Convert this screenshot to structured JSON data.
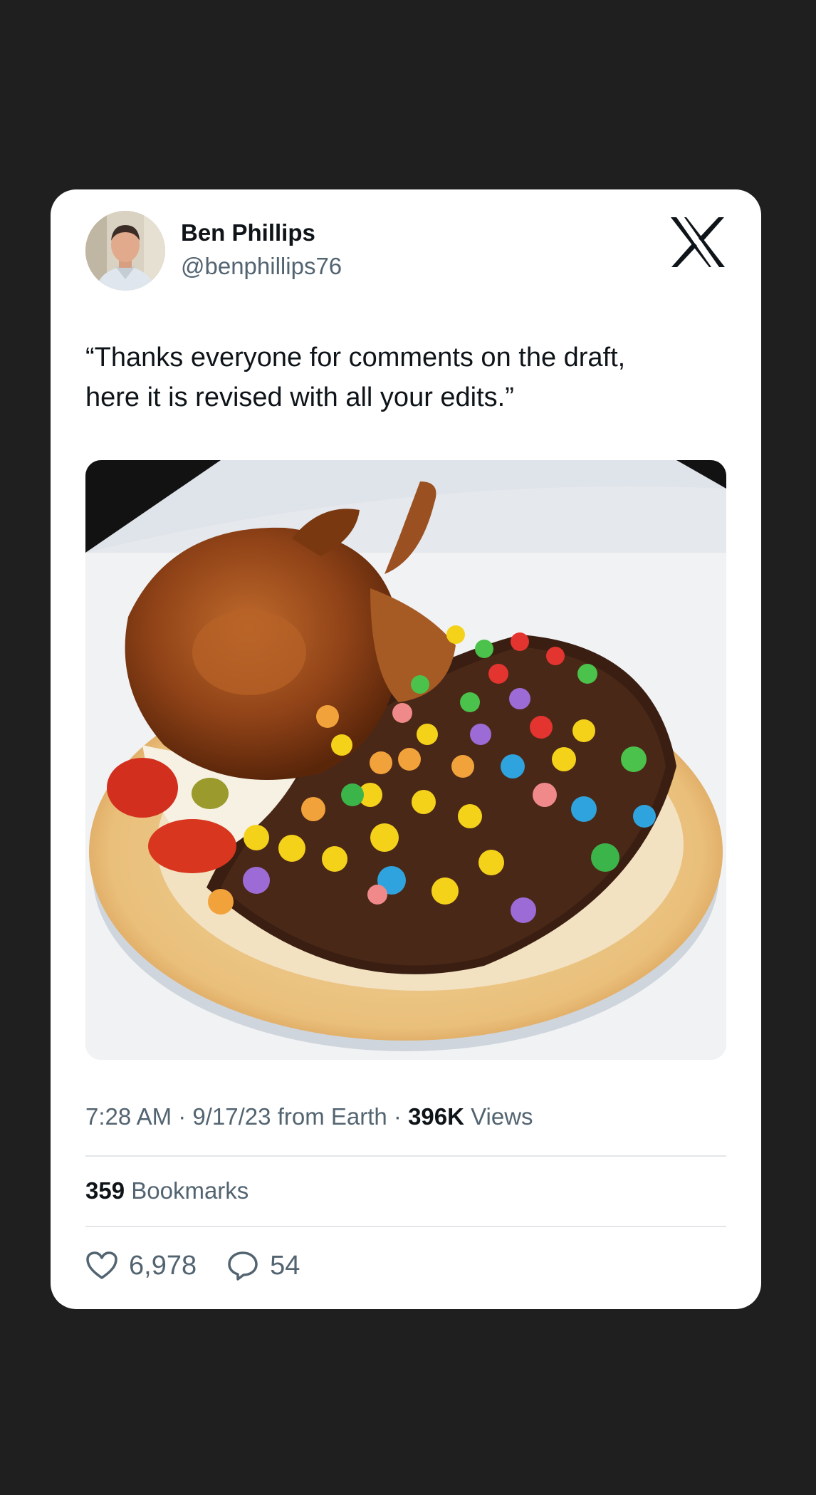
{
  "tweet": {
    "author_name": "Ben Phillips",
    "author_handle": "@benphillips76",
    "text_line1": "“Thanks everyone for comments on the draft,",
    "text_line2": "here it is revised with all your edits.”",
    "time": "7:28 AM",
    "date": "9/17/23",
    "source": "from Earth",
    "views_count": "396K",
    "views_label": "Views",
    "bookmarks_count": "359",
    "bookmarks_label": "Bookmarks",
    "likes": "6,978",
    "replies": "54"
  },
  "icons": {
    "platform_logo": "x-logo-icon",
    "like": "heart-icon",
    "reply": "speech-bubble-icon"
  },
  "colors": {
    "background": "#1f1f1f",
    "card": "#ffffff",
    "text_primary": "#0f1419",
    "text_secondary": "#536471"
  }
}
